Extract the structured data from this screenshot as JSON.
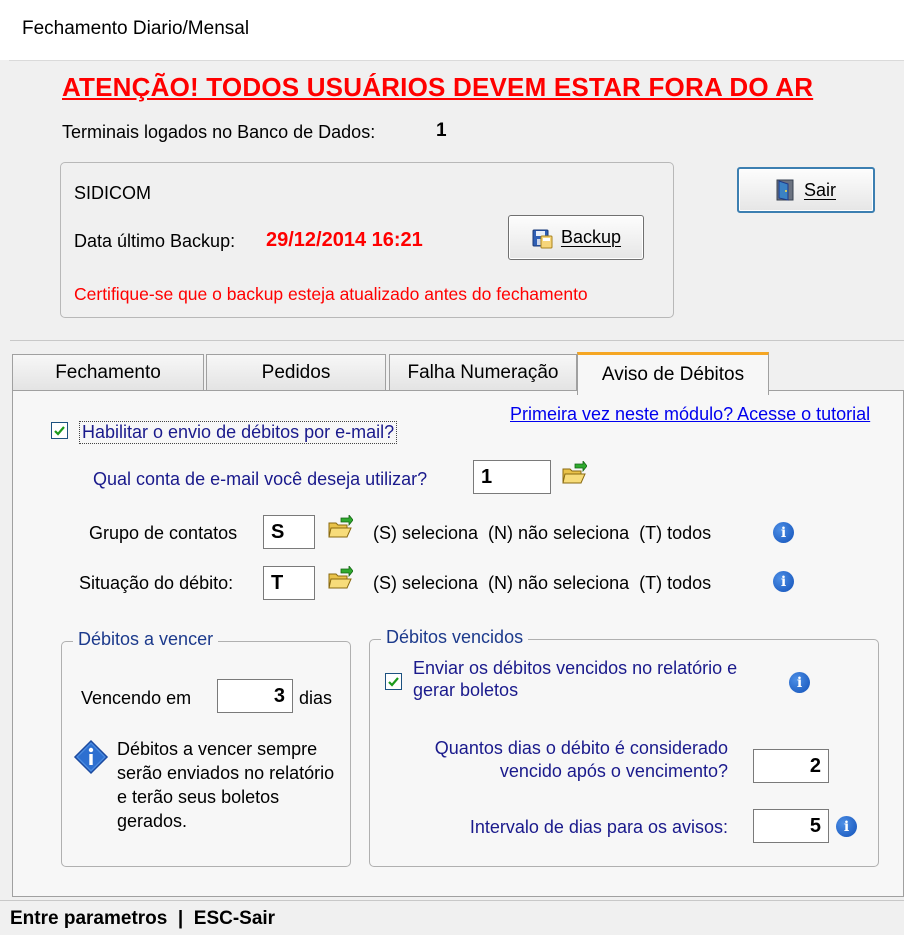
{
  "window": {
    "title": "Fechamento Diario/Mensal"
  },
  "warning": "ATENÇÃO! TODOS USUÁRIOS DEVEM ESTAR FORA DO AR",
  "terminals": {
    "label": "Terminais logados no Banco de Dados:",
    "value": "1"
  },
  "backup_box": {
    "name": "SIDICOM",
    "last_backup_label": "Data último Backup:",
    "last_backup_value": "29/12/2014 16:21",
    "backup_button": "Backup",
    "note": "Certifique-se que o backup esteja atualizado antes do fechamento"
  },
  "exit_button": "Sair",
  "tabs": [
    {
      "label": "Fechamento",
      "active": false
    },
    {
      "label": "Pedidos",
      "active": false
    },
    {
      "label": "Falha Numeração",
      "active": false
    },
    {
      "label": "Aviso de Débitos",
      "active": true
    }
  ],
  "aviso": {
    "enable_label": "Habilitar o envio de débitos por e-mail?",
    "enable_checked": true,
    "tutorial_link": "Primeira vez neste módulo? Acesse o tutorial",
    "email_account_label": "Qual conta de e-mail você deseja utilizar?",
    "email_account_value": "1",
    "contact_group_label": "Grupo de contatos",
    "contact_group_value": "S",
    "contact_group_hint": "(S) seleciona  (N) não seleciona  (T) todos",
    "debt_status_label": "Situação do débito:",
    "debt_status_value": "T",
    "debt_status_hint": "(S) seleciona  (N) não seleciona  (T) todos",
    "upcoming": {
      "legend": "Débitos a vencer",
      "due_in_label": "Vencendo em",
      "due_in_value": "3",
      "due_in_unit": "dias",
      "info_text": "Débitos a vencer sempre serão enviados no relatório e terão seus boletos gerados."
    },
    "overdue": {
      "legend": "Débitos vencidos",
      "send_label": "Enviar os débitos vencidos no relatório e gerar boletos",
      "send_checked": true,
      "days_overdue_label": "Quantos dias o débito é considerado vencido após o vencimento?",
      "days_overdue_value": "2",
      "interval_label": "Intervalo de dias para os avisos:",
      "interval_value": "5"
    }
  },
  "status_bar": "Entre parametros  |  ESC-Sair",
  "colors": {
    "warning": "#ff0000",
    "link": "#0000ee",
    "tab_accent": "#f5a623",
    "info_icon": "#1251b8"
  },
  "icons": [
    "exit-door-icon",
    "backup-disk-icon",
    "open-folder-icon",
    "info-icon",
    "checkmark-icon"
  ]
}
